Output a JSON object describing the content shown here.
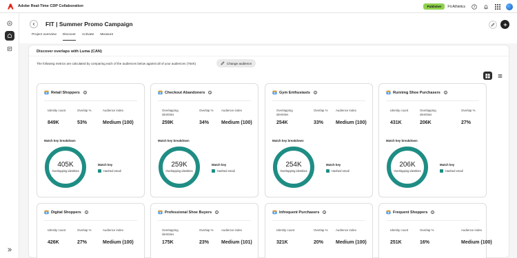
{
  "app": {
    "title": "Adobe Real-Time CDP Collaboration",
    "badge": "Publisher",
    "org": "Fit Athletics"
  },
  "header": {
    "title": "FIT | Summer Promo Campaign",
    "tabs": [
      {
        "label": "Project overview"
      },
      {
        "label": "Discover"
      },
      {
        "label": "Activate"
      },
      {
        "label": "Measure"
      }
    ],
    "active_tab": "Discover"
  },
  "panel": {
    "title": "Discover overlaps with Luma (CAN)",
    "description": "The following metrics are calculated by comparing each of the audiences below against all of your audiences (764K)",
    "change_button": "Change audience"
  },
  "colors": {
    "accent": "#1e8d84",
    "badge": "#8fd14f"
  },
  "cards": [
    {
      "name": "Retail Shoppers",
      "m1_label": "Identity count",
      "m1_value": "849K",
      "m2_label": "Overlap %",
      "m2_value": "53%",
      "m3_label": "Audience index",
      "m3_value": "Medium (100)",
      "mkb": "Match key breakdown",
      "donut_value": "405K",
      "donut_label": "Overlapping identities",
      "mk_label": "Match key",
      "mk_item": "Hashed email"
    },
    {
      "name": "Checkout Abandoners",
      "m1_label": "Overlapping identities",
      "m1_value": "259K",
      "m2_label": "Overlap %",
      "m2_value": "34%",
      "m3_label": "Audience index",
      "m3_value": "Medium (100)",
      "mkb": "Match key breakdown",
      "donut_value": "259K",
      "donut_label": "Overlapping identities",
      "mk_label": "Match key",
      "mk_item": "Hashed email"
    },
    {
      "name": "Gym Enthusiasts",
      "m1_label": "Overlapping identities",
      "m1_value": "254K",
      "m2_label": "Overlap %",
      "m2_value": "33%",
      "m3_label": "Audience index",
      "m3_value": "Medium (100)",
      "mkb": "Match key breakdown",
      "donut_value": "254K",
      "donut_label": "Overlapping identities",
      "mk_label": "Match key",
      "mk_item": "Hashed email"
    },
    {
      "name": "Running Shoe Purchasers",
      "m1_label": "Identity count",
      "m1_value": "431K",
      "m2_label": "Overlapping identities",
      "m2_value": "206K",
      "m3_label": "Overlap %",
      "m3_value": "27%",
      "mkb": "Match key breakdown",
      "donut_value": "206K",
      "donut_label": "Overlapping identities",
      "mk_label": "Match key",
      "mk_item": "Hashed email"
    },
    {
      "name": "Digital Shoppers",
      "m1_label": "Identity count",
      "m1_value": "426K",
      "m2_label": "Overlap %",
      "m2_value": "27%",
      "m3_label": "Audience index",
      "m3_value": "Medium (100)"
    },
    {
      "name": "Professional Shoe Buyers",
      "m1_label": "Overlapping identities",
      "m1_value": "175K",
      "m2_label": "Overlap %",
      "m2_value": "23%",
      "m3_label": "Audience index",
      "m3_value": "Medium (101)"
    },
    {
      "name": "Infrequent Purchasers",
      "m1_label": "Identity count",
      "m1_value": "321K",
      "m2_label": "Overlap %",
      "m2_value": "20%",
      "m3_label": "Audience index",
      "m3_value": "Medium (100)"
    },
    {
      "name": "Frequent Shoppers",
      "m1_label": "Identity count",
      "m1_value": "251K",
      "m2_label": "Overlap %",
      "m2_value": "16%",
      "m3_label": "Audience index",
      "m3_value": "Medium (100)"
    }
  ]
}
